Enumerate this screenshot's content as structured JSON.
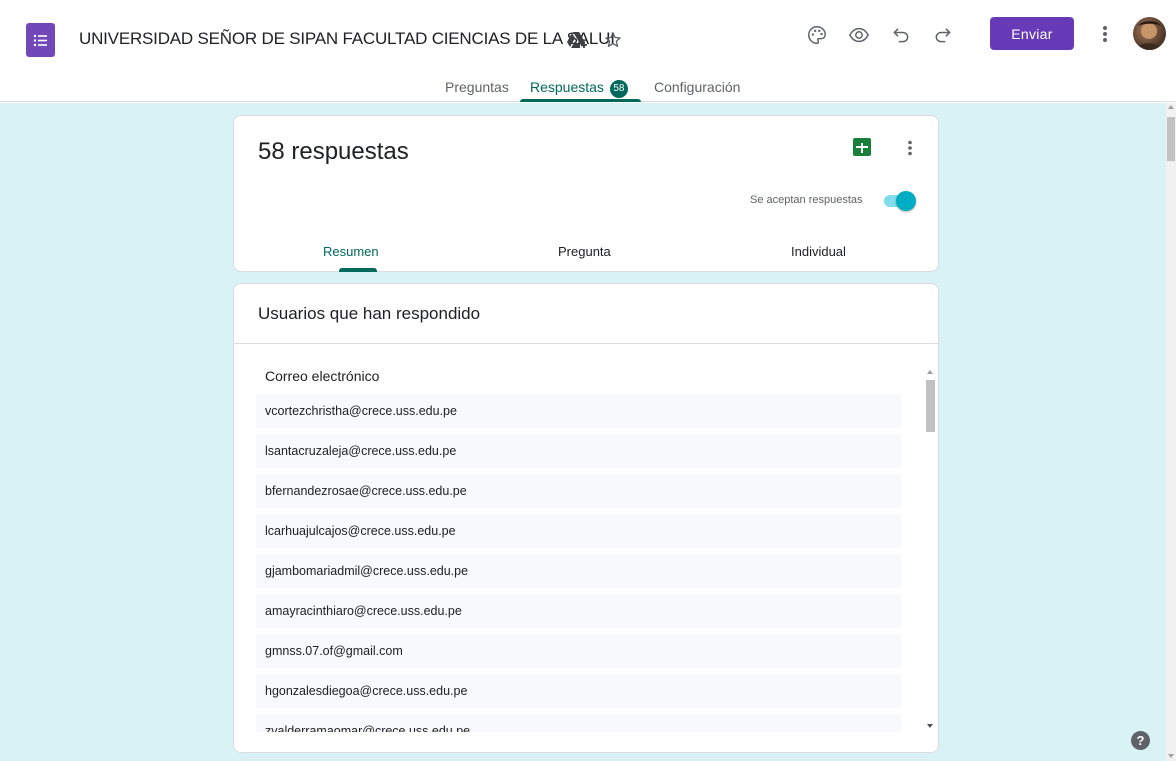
{
  "app": {
    "title": "UNIVERSIDAD SEÑOR DE SIPAN FACULTAD CIENCIAS DE LA SALUI",
    "send_label": "Enviar",
    "icons": [
      "forms-icon",
      "drive-add-icon",
      "star-icon",
      "palette-icon",
      "preview-eye-icon",
      "undo-icon",
      "redo-icon",
      "more-vert-icon",
      "avatar"
    ]
  },
  "tabs": [
    {
      "label": "Preguntas"
    },
    {
      "label": "Respuestas",
      "badge": "58"
    },
    {
      "label": "Configuración"
    }
  ],
  "summary": {
    "count_label": "58 respuestas",
    "accepting_label": "Se aceptan respuestas",
    "accepting": true,
    "subtabs": [
      "Resumen",
      "Pregunta",
      "Individual"
    ]
  },
  "respondents": {
    "title": "Usuarios que han respondido",
    "column_label": "Correo electrónico",
    "emails": [
      "vcortezchristha@crece.uss.edu.pe",
      "lsantacruzaleja@crece.uss.edu.pe",
      "bfernandezrosae@crece.uss.edu.pe",
      "lcarhuajulcajos@crece.uss.edu.pe",
      "gjambomariadmil@crece.uss.edu.pe",
      "amayracinthiaro@crece.uss.edu.pe",
      "gmnss.07.of@gmail.com",
      "hgonzalesdiegoa@crece.uss.edu.pe",
      "zvalderramaomar@crece.uss.edu.pe"
    ]
  },
  "help": {
    "label": "?"
  },
  "colors": {
    "accent_purple": "#673ab7",
    "teal": "#00695c",
    "background": "#d8f2f6",
    "toggle_knob": "#00acc1",
    "sheets_green": "#188038"
  }
}
